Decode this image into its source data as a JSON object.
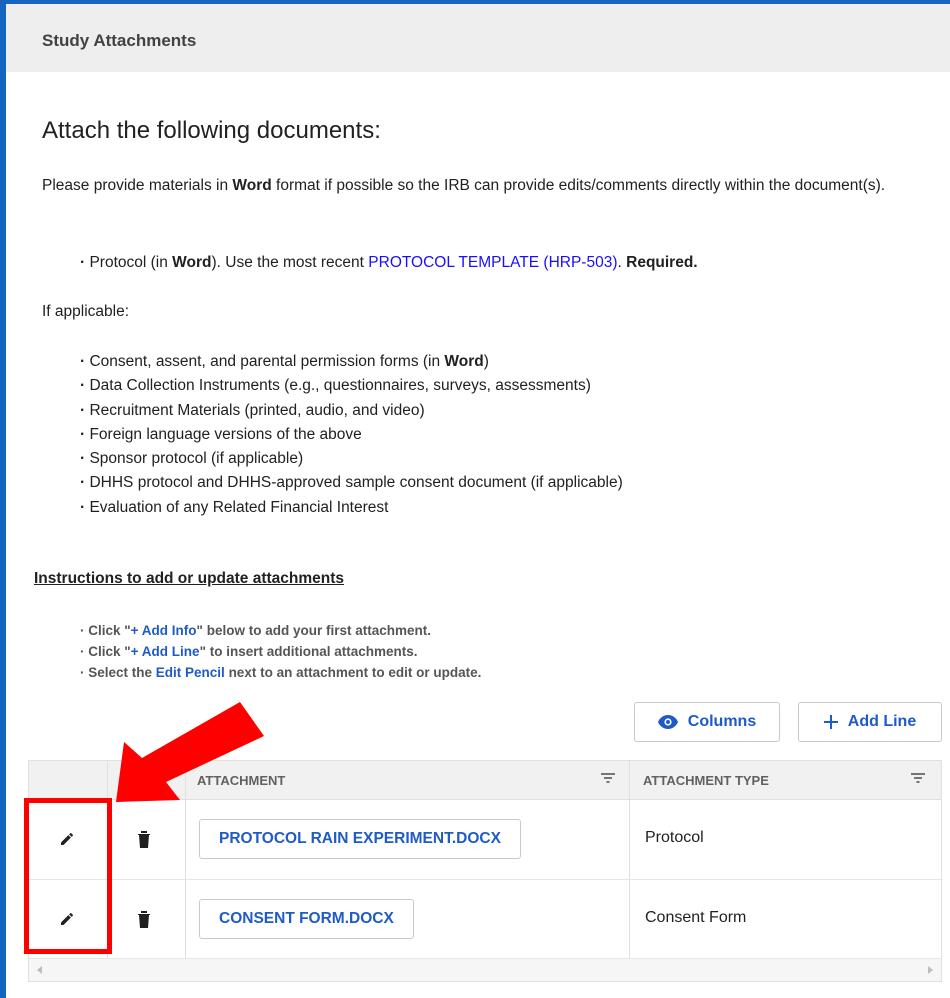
{
  "panel": {
    "title": "Study Attachments"
  },
  "heading": "Attach the following documents:",
  "intro": {
    "pre": "Please provide materials in ",
    "bold": "Word",
    "post": " format if possible so the IRB can provide edits/comments directly within the document(s)."
  },
  "protocol_line": {
    "bullet": "· ",
    "a": "Protocol (in ",
    "word": "Word",
    "b": "). Use the most recent ",
    "link": "PROTOCOL TEMPLATE (HRP-503)",
    "c": ". ",
    "required": "Required."
  },
  "if_applicable": "If applicable:",
  "applicable_items": [
    {
      "a": "Consent, assent, and parental permission forms (in ",
      "bold": "Word",
      "b": ")"
    },
    {
      "a": "Data Collection Instruments (e.g., questionnaires, surveys, assessments)"
    },
    {
      "a": "Recruitment Materials (printed, audio, and video)"
    },
    {
      "a": "Foreign language versions of the above"
    },
    {
      "a": "Sponsor protocol",
      "b": " (if applicable)"
    },
    {
      "a": "DHHS protocol and DHHS-approved sample consent document (if applicable)"
    },
    {
      "a": "Evaluation of any Related Financial Interest"
    }
  ],
  "instructions": {
    "title": "Instructions to add or update attachments",
    "items": [
      {
        "pre": "· Click \"",
        "link": "+ Add Info",
        "post": "\" below to add your first attachment."
      },
      {
        "pre": "· Click \"",
        "link": "+ Add Line",
        "post": "\" to insert additional attachments."
      },
      {
        "pre": "· Select the ",
        "link": "Edit Pencil",
        "post": " next to an attachment to edit or update."
      }
    ]
  },
  "toolbar": {
    "columns_label": "Columns",
    "add_line_label": "Add Line"
  },
  "table": {
    "headers": [
      "Attachment",
      "Attachment Type"
    ],
    "rows": [
      {
        "attachment": "PROTOCOL RAIN EXPERIMENT.DOCX",
        "type": "Protocol"
      },
      {
        "attachment": "CONSENT FORM.DOCX",
        "type": "Consent Form"
      }
    ]
  },
  "annotation": {
    "arrow_color": "#ff0000",
    "box_color": "#ff0000"
  },
  "colors": {
    "accent_border": "#1565c0",
    "link": "#1e5bc6",
    "template_link": "#1a0dff"
  }
}
